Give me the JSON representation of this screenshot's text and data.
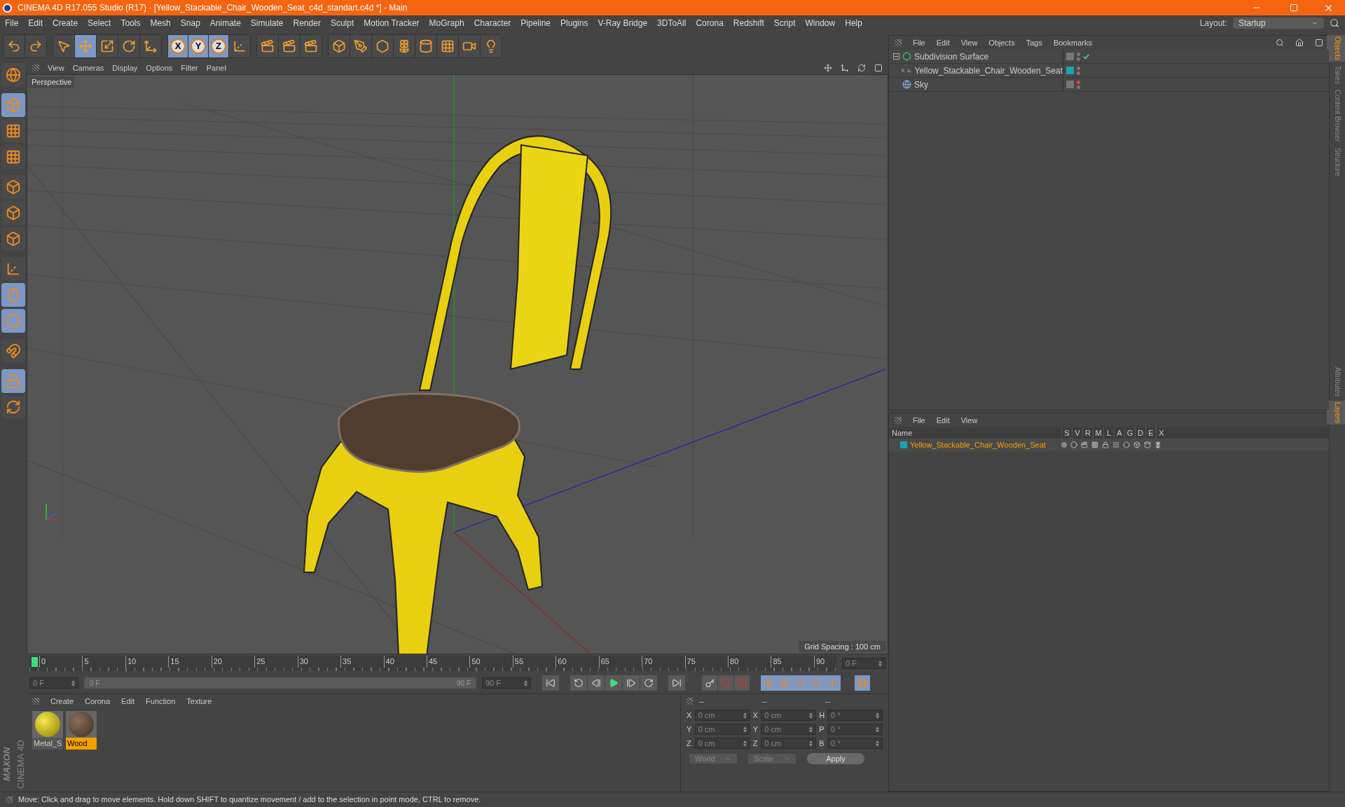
{
  "window": {
    "title": "CINEMA 4D R17.055 Studio (R17) - [Yellow_Stackable_Chair_Wooden_Seat_c4d_standart.c4d *] - Main"
  },
  "menu": [
    "File",
    "Edit",
    "Create",
    "Select",
    "Tools",
    "Mesh",
    "Snap",
    "Animate",
    "Simulate",
    "Render",
    "Sculpt",
    "Motion Tracker",
    "MoGraph",
    "Character",
    "Pipeline",
    "Plugins",
    "V-Ray Bridge",
    "3DToAll",
    "Corona",
    "Redshift",
    "Script",
    "Window",
    "Help"
  ],
  "layout": {
    "label": "Layout:",
    "value": "Startup"
  },
  "toolbar": [
    {
      "kind": "undo",
      "selected": false
    },
    {
      "kind": "redo",
      "selected": false
    },
    {
      "kind": "select",
      "selected": false
    },
    {
      "kind": "move",
      "selected": true
    },
    {
      "kind": "scale",
      "selected": false
    },
    {
      "kind": "rotate",
      "selected": false
    },
    {
      "kind": "transform",
      "selected": false
    },
    {
      "kind": "axis",
      "label": "X",
      "selected": true
    },
    {
      "kind": "axis",
      "label": "Y",
      "selected": true
    },
    {
      "kind": "axis",
      "label": "Z",
      "selected": true
    },
    {
      "kind": "coords",
      "selected": false
    },
    {
      "kind": "render-view",
      "selected": false
    },
    {
      "kind": "render",
      "selected": false
    },
    {
      "kind": "render-settings",
      "selected": false
    },
    {
      "kind": "cube",
      "selected": false
    },
    {
      "kind": "pen",
      "selected": false
    },
    {
      "kind": "subdivision",
      "selected": false
    },
    {
      "kind": "cloner",
      "selected": false
    },
    {
      "kind": "deformer",
      "selected": false
    },
    {
      "kind": "floor",
      "selected": false
    },
    {
      "kind": "camera",
      "selected": false
    },
    {
      "kind": "light",
      "selected": false
    }
  ],
  "left_tools": [
    {
      "kind": "globe",
      "selected": false
    },
    {
      "kind": "model",
      "selected": true
    },
    {
      "kind": "texture",
      "selected": false
    },
    {
      "kind": "workplane",
      "selected": false
    },
    {
      "kind": "points",
      "selected": false
    },
    {
      "kind": "edges",
      "selected": false
    },
    {
      "kind": "polygons",
      "selected": false
    },
    {
      "kind": "axis",
      "selected": false
    },
    {
      "kind": "mouse",
      "selected": true
    },
    {
      "kind": "snap",
      "selected": true
    },
    {
      "kind": "magnet",
      "selected": false
    },
    {
      "kind": "grid-lock",
      "selected": true
    },
    {
      "kind": "grid-cycle",
      "selected": false
    }
  ],
  "viewport": {
    "menu": [
      "View",
      "Cameras",
      "Display",
      "Options",
      "Filter",
      "Panel"
    ],
    "camera": "Perspective",
    "grid_spacing": "Grid Spacing : 100 cm"
  },
  "timeline": {
    "ticks": [
      "0",
      "5",
      "10",
      "15",
      "20",
      "25",
      "30",
      "35",
      "40",
      "45",
      "50",
      "55",
      "60",
      "65",
      "70",
      "75",
      "80",
      "85",
      "90"
    ],
    "current_frame": "0 F",
    "start": "0 F",
    "range_start": "0 F",
    "range_end": "90 F",
    "level": 1,
    "end": "90 F"
  },
  "materials": {
    "menu": [
      "Create",
      "Corona",
      "Edit",
      "Function",
      "Texture"
    ],
    "items": [
      {
        "name": "Metal_S",
        "kind": "metal",
        "selected": false
      },
      {
        "name": "Wood",
        "kind": "wood",
        "selected": true
      }
    ]
  },
  "coordinates": {
    "headers": [
      "--",
      "--",
      "--"
    ],
    "rows": [
      {
        "a": "X",
        "a_value": "0 cm",
        "b": "X",
        "b_value": "0 cm",
        "c": "H",
        "c_value": "0 °"
      },
      {
        "a": "Y",
        "a_value": "0 cm",
        "b": "Y",
        "b_value": "0 cm",
        "c": "P",
        "c_value": "0 °"
      },
      {
        "a": "Z",
        "a_value": "0 cm",
        "b": "Z",
        "b_value": "0 cm",
        "c": "B",
        "c_value": "0 °"
      }
    ],
    "space": "World",
    "mode": "Scale",
    "apply": "Apply"
  },
  "logo": {
    "top": "MAXON",
    "bottom": "CINEMA 4D"
  },
  "status_bar": "Move: Click and drag to move elements. Hold down SHIFT to quantize movement / add to the selection in point mode, CTRL to remove.",
  "objects": {
    "menu": [
      "File",
      "Edit",
      "View",
      "Objects",
      "Tags",
      "Bookmarks"
    ],
    "items": [
      {
        "name": "Subdivision Surface",
        "kind": "subdivision",
        "expanded": true,
        "enabled": true,
        "editor_visible": true,
        "children": [
          {
            "name": "Yellow_Stackable_Chair_Wooden_Seat",
            "kind": "null",
            "expanded": false,
            "enabled": false,
            "editor_visible": true,
            "color": "#1aa3b0"
          }
        ]
      },
      {
        "name": "Sky",
        "kind": "sky",
        "enabled": false,
        "editor_visible": false
      }
    ]
  },
  "layers": {
    "menu": [
      "File",
      "Edit",
      "View"
    ],
    "columns": [
      "Name",
      "S",
      "V",
      "R",
      "M",
      "L",
      "A",
      "G",
      "D",
      "E",
      "X"
    ],
    "rows": [
      {
        "name": "Yellow_Stackable_Chair_Wooden_Seat",
        "color": "#1aa3b0"
      }
    ]
  },
  "side_tabs": [
    {
      "label": "Objects",
      "selected": true
    },
    {
      "label": "Takes",
      "selected": false
    },
    {
      "label": "Content Browser",
      "selected": false
    },
    {
      "label": "Structure",
      "selected": false
    }
  ],
  "side_tabs_lower": [
    {
      "label": "Attributes",
      "selected": false
    },
    {
      "label": "Layers",
      "selected": true
    }
  ]
}
